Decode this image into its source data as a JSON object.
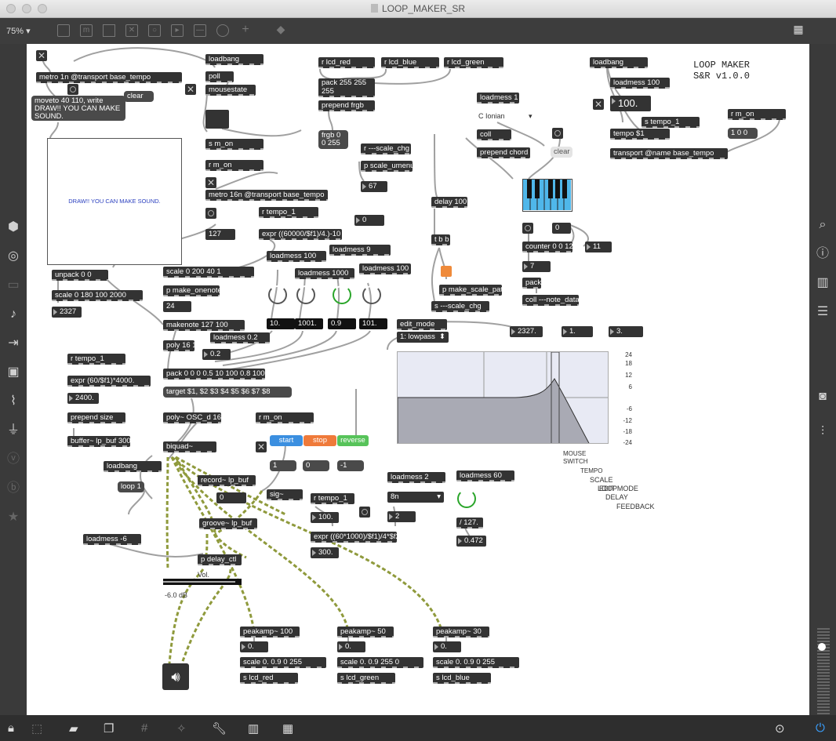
{
  "window": {
    "title": "LOOP_MAKER_SR"
  },
  "toolbar": {
    "zoom": "75%"
  },
  "canvas": {
    "heading": "LOOP MAKER\nS&R v1.0.0",
    "lcd_text": "DRAW!! YOU CAN MAKE SOUND.",
    "objects": {
      "o1": "metro 1n @transport base_tempo",
      "o2": "loadbang",
      "o3": "poll",
      "o4": "mousestate",
      "o5": "moveto 40 110, write DRAW!! YOU CAN MAKE SOUND.",
      "o6": "clear",
      "o7": "s m_on",
      "o8": "r m_on",
      "o9": "metro 16n @transport base_tempo",
      "o10": "127",
      "o11": "r lcd_red",
      "o12": "r lcd_blue",
      "o13": "r lcd_green",
      "o14": "pack 255 255 255",
      "o15": "prepend frgb",
      "o16": "frgb 0 0 255",
      "o17": "r ---scale_chg",
      "o18": "p scale_umenu",
      "o19": "67",
      "o20": "r tempo_1",
      "o21": "expr ((60000/$f1)/4.)-10",
      "o22": "0",
      "o23": "loadmess 100",
      "o24": "loadmess 9",
      "o25": "loadmess 1000",
      "o26": "loadmess 100",
      "o27": "unpack 0 0",
      "o28": "scale 0 180 100 2000",
      "o29": "2327",
      "o30": "scale 0 200 40 1",
      "o31": "p make_onenote",
      "o32": "24",
      "o33": "makenote 127 100",
      "o34": "loadmess 0.2",
      "o35": "0.2",
      "o36": "poly 16 1",
      "o37": "pack 0 0 0 0.5 10 100 0.8 1000",
      "o38": "target $1, $2 $3 $4 $5 $6 $7 $8",
      "o39": "poly~ OSC_d 16",
      "o40": "r m_on",
      "o41": "r tempo_1",
      "o42": "expr (60/$f1)*4000.",
      "o43": "2400.",
      "o44": "prepend size",
      "o45": "buffer~ lp_buf 3000",
      "o46": "biquad~",
      "o47": "loadbang",
      "o48": "loop 1",
      "o49": "record~ lp_buf",
      "o50": "0",
      "o51": "sig~",
      "o52": "groove~ lp_buf",
      "o53": "loadmess -6",
      "o54": "p delay_ctl",
      "o55": "loadmess 1",
      "o56": "coll",
      "o57": "prepend chord",
      "o58": "delay 100",
      "o59": "t b b",
      "o60": "p make_scale_pat",
      "o61": "s ---scale_chg",
      "o62": "loadbang",
      "o63": "loadmess 100",
      "o64": "100.",
      "o65": "s tempo_1",
      "o66": "tempo $1",
      "o67": "transport @name base_tempo",
      "o68": "r m_on",
      "o69": "1 0 0",
      "o70": "0",
      "o71": "counter 0 0 12",
      "o72": "11",
      "o73": "7",
      "o74": "pack",
      "o75": "coll ---note_data",
      "o76": "edit_mode",
      "o77": "1: lowpass",
      "o78": "2327.",
      "o79": "1.",
      "o80": "3.",
      "o81": "1",
      "o82": "0",
      "o83": "-1",
      "o84": "r tempo_1",
      "o85": "100.",
      "o86": "expr ((60*1000)/$f1)/4*$f2",
      "o87": "300.",
      "o88": "loadmess 2",
      "o89": "8n",
      "o90": "2",
      "o91": "loadmess 60",
      "o92": "/ 127.",
      "o93": "0.472",
      "o94": "peakamp~ 100",
      "o95": "peakamp~ 50",
      "o96": "peakamp~ 30",
      "o97": "0.",
      "o98": "0.",
      "o99": "0.",
      "o100": "scale 0. 0.9 0 255",
      "o101": "scale 0. 0.9 255 0",
      "o102": "scale 0. 0.9 0 255",
      "o103": "s lcd_red",
      "o104": "s lcd_green",
      "o105": "s lcd_blue",
      "o106": "C Ionian",
      "o107": "clear"
    },
    "dials": [
      "10.",
      "1001.",
      "0.9",
      "101."
    ],
    "buttons": {
      "start": "start",
      "stop": "stop",
      "reverse": "reverse"
    },
    "filter_ticks": [
      "24",
      "18",
      "12",
      "6",
      "-6",
      "-12",
      "-18",
      "-24"
    ],
    "labels": {
      "mouse_switch": "MOUSE\nSWITCH",
      "tempo": "TEMPO",
      "scale": "SCALE",
      "edit_mode": "EDIT MODE",
      "loop": "LOOP",
      "delay": "DELAY",
      "feedback": "FEEDBACK",
      "vol": "Vol.",
      "gain": "-6.0 dB"
    },
    "colors": {
      "start": "#3b8fe0",
      "stop": "#ef7a3a",
      "reverse": "#57c35a",
      "keyboard": "#4fb7ea",
      "patch_cord": "#a0a0a0",
      "signal_cord": "#8f9a3c"
    }
  }
}
